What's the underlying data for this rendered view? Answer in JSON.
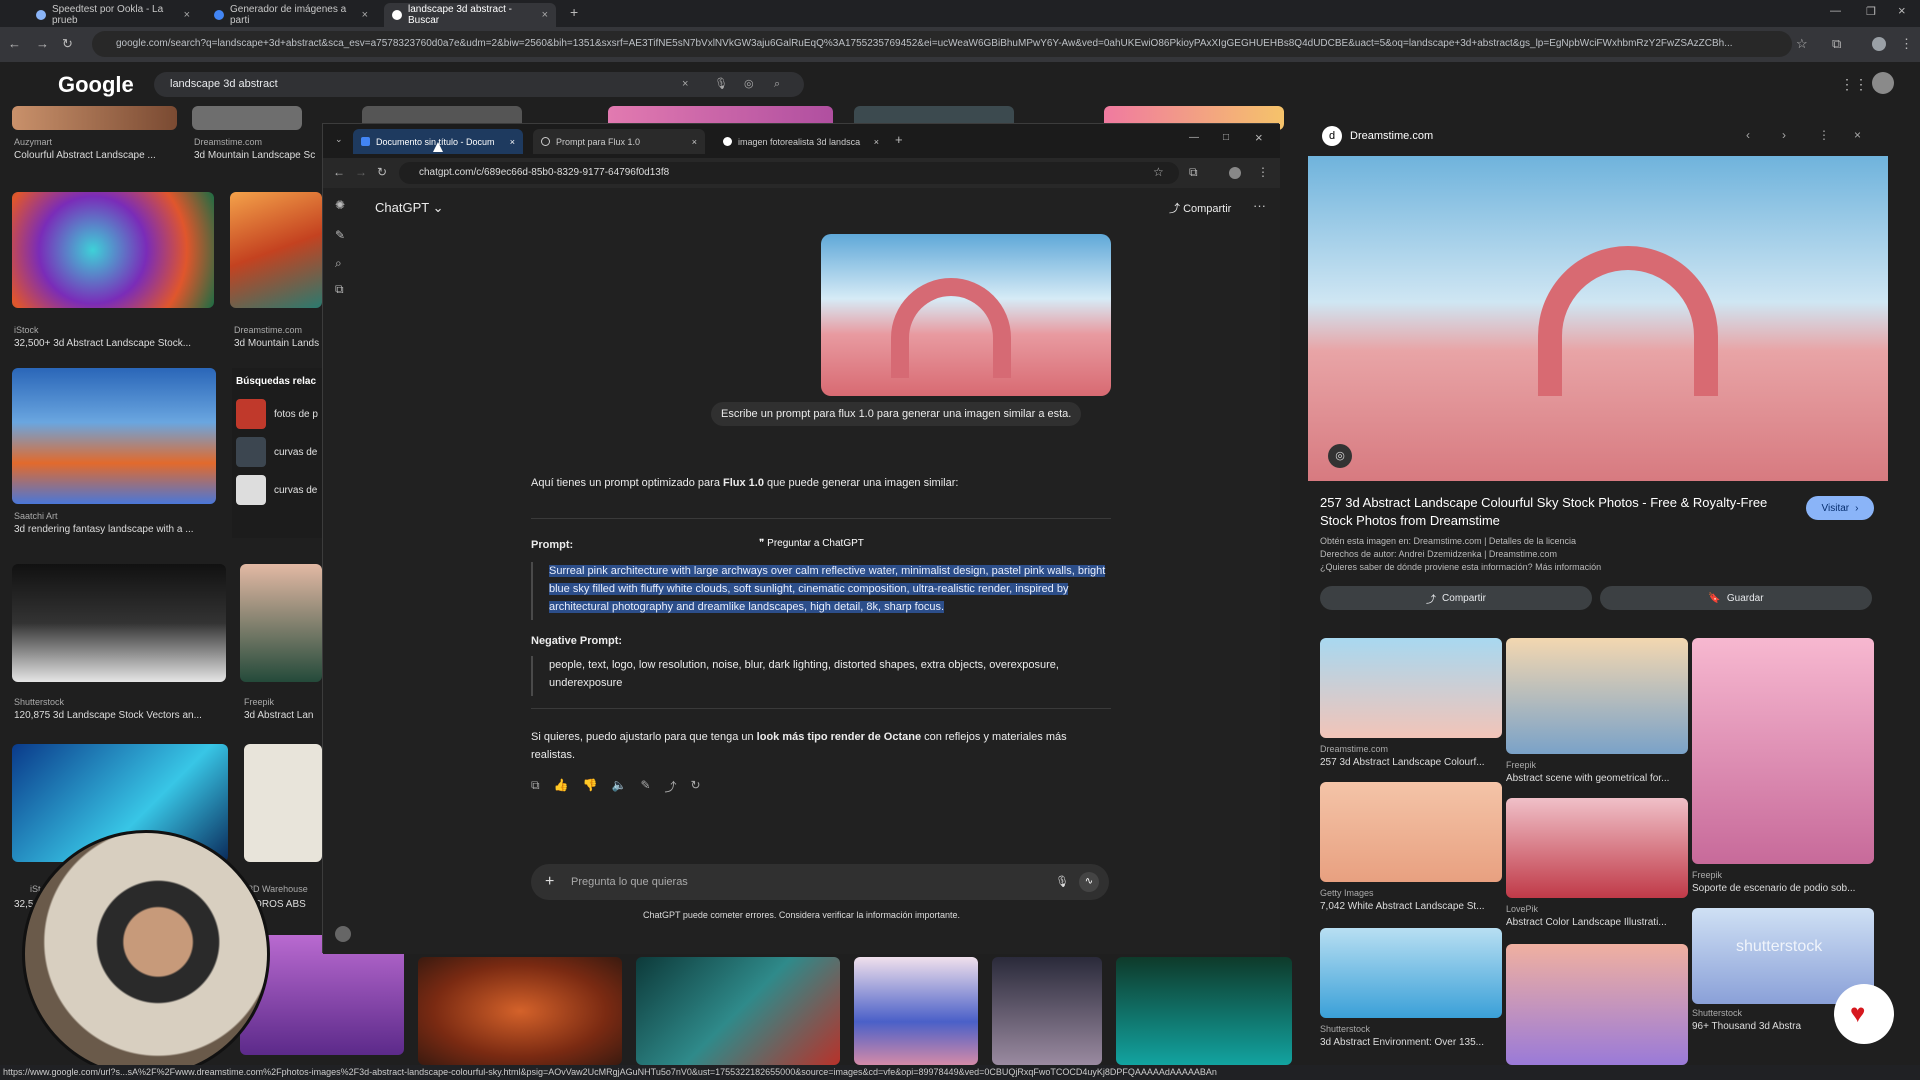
{
  "browser": {
    "tabs": [
      {
        "label": "Speedtest por Ookla - La prueb"
      },
      {
        "label": "Generador de imágenes a parti"
      },
      {
        "label": "landscape 3d abstract - Buscar"
      }
    ],
    "url": "google.com/search?q=landscape+3d+abstract&sca_esv=a7578323760d0a7e&udm=2&biw=2560&bih=1351&sxsrf=AE3TifNE5sN7bVxlNVkGW3aju6GalRuEqQ%3A1755235769452&ei=ucWeaW6GBiBhuMPwY6Y-Aw&ved=0ahUKEwiO86PkioyPAxXIgGEGHUEHBs8Q4dUDCBE&uact=5&oq=landscape+3d+abstract&gs_lp=EgNpbWciFWxhbmRzY2FwZSAzZCBh..."
  },
  "google": {
    "logo": "Google",
    "query": "landscape 3d abstract",
    "results": [
      {
        "source": "Auzymart",
        "title": "Colourful Abstract Landscape ..."
      },
      {
        "source": "Dreamstime.com",
        "title": "3d Mountain Landscape Sc"
      },
      {
        "source": "iStock",
        "title": "32,500+ 3d Abstract Landscape Stock..."
      },
      {
        "source": "Dreamstime.com",
        "title": "3d Mountain Lands"
      },
      {
        "source": "Saatchi Art",
        "title": "3d rendering fantasy landscape with a ..."
      },
      {
        "source": "Shutterstock",
        "title": "120,875 3d Landscape Stock Vectors an..."
      },
      {
        "source": "Freepik",
        "title": "3d Abstract Lan"
      },
      {
        "source": "iSt",
        "title": "32,5"
      },
      {
        "source": "3D Warehouse",
        "title": "ADROS ABS"
      }
    ],
    "related_title": "Búsquedas relac",
    "related": [
      "fotos de p",
      "curvas de",
      "curvas de"
    ]
  },
  "chatgpt_window": {
    "tabs": [
      {
        "label": "Documento sin título - Docum"
      },
      {
        "label": "Prompt para Flux 1.0"
      },
      {
        "label": "imagen fotorealista 3d landsca"
      }
    ],
    "url": "chatgpt.com/c/689ec66d-85b0-8329-9177-64796f0d13f8",
    "model": "ChatGPT",
    "share": "Compartir",
    "user_message": "Escribe un prompt para flux 1.0 para generar una imagen similar a esta.",
    "intro_pre": "Aquí tienes un prompt optimizado para ",
    "intro_bold": "Flux 1.0",
    "intro_post": " que puede generar una imagen similar:",
    "prompt_label": "Prompt:",
    "ask_chatgpt": "Preguntar a ChatGPT",
    "prompt_text": "Surreal pink architecture with large archways over calm reflective water, minimalist design, pastel pink walls, bright blue sky filled with fluffy white clouds, soft sunlight, cinematic composition, ultra-realistic render, inspired by architectural photography and dreamlike landscapes, high detail, 8k, sharp focus.",
    "negative_label": "Negative Prompt:",
    "negative_text": "people, text, logo, low resolution, noise, blur, dark lighting, distorted shapes, extra objects, overexposure, underexposure",
    "followup_pre": "Si quieres, puedo ajustarlo para que tenga un ",
    "followup_bold": "look más tipo render de Octane",
    "followup_post": " con reflejos y materiales más realistas.",
    "input_placeholder": "Pregunta lo que quieras",
    "disclaimer": "ChatGPT puede cometer errores. Considera verificar la información importante."
  },
  "preview": {
    "source": "Dreamstime.com",
    "title": "257 3d Abstract Landscape Colourful Sky Stock Photos - Free & Royalty-Free Stock Photos from Dreamstime",
    "visit": "Visitar",
    "info1": "Obtén esta imagen en: Dreamstime.com | Detalles de la licencia",
    "info2": "Derechos de autor: Andrei Dzemidzenka | Dreamstime.com",
    "info3": "¿Quieres saber de dónde proviene esta información? Más información",
    "share": "Compartir",
    "save": "Guardar",
    "related": [
      {
        "source": "Dreamstime.com",
        "title": "257 3d Abstract Landscape Colourf..."
      },
      {
        "source": "Freepik",
        "title": "Abstract scene with geometrical for..."
      },
      {
        "source": "Freepik",
        "title": "Soporte de escenario de podio sob..."
      },
      {
        "source": "Getty Images",
        "title": "7,042 White Abstract Landscape St..."
      },
      {
        "source": "LovePik",
        "title": "Abstract Color Landscape Illustrati..."
      },
      {
        "source": "Shutterstock",
        "title": "96+ Thousand 3d Abstra"
      },
      {
        "source": "Shutterstock",
        "title": "3d Abstract Environment: Over 135..."
      }
    ],
    "watermark": "shutterstock"
  },
  "status_url": "https://www.google.com/url?s...sA%2F%2Fwww.dreamstime.com%2Fphotos-images%2F3d-abstract-landscape-colourful-sky.html&psig=AOvVaw2UcMRgjAGuNHTu5o7nV0&ust=1755322182655000&source=images&cd=vfe&opi=89978449&ved=0CBUQjRxqFwoTCOCD4uyKj8DPFQAAAAAdAAAAABAn",
  "icons": [
    "search-icon",
    "mic-icon",
    "camera-icon",
    "close-icon",
    "star-icon",
    "pencil-icon",
    "like-icon",
    "dislike-icon",
    "copy-icon",
    "speaker-icon",
    "share-icon",
    "refresh-icon",
    "plus-icon"
  ]
}
